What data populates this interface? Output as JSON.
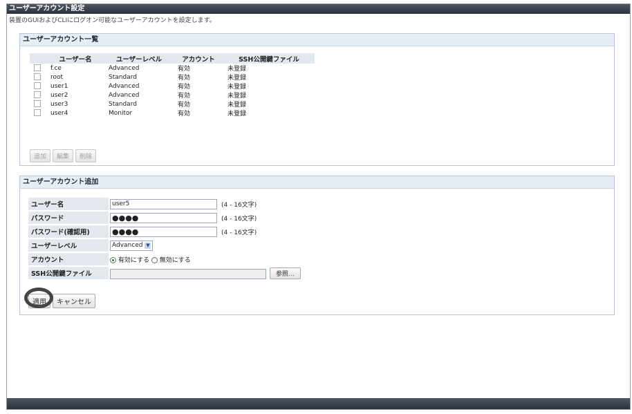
{
  "window": {
    "title": "ユーザーアカウント設定",
    "subtitle": "装置のGUIおよびCLIにログオン可能なユーザーアカウントを設定します。"
  },
  "list_panel": {
    "title": "ユーザーアカウント一覧",
    "columns": [
      "ユーザー名",
      "ユーザーレベル",
      "アカウント",
      "SSH公開鍵ファイル"
    ],
    "rows": [
      {
        "name": "f.ce",
        "level": "Advanced",
        "account": "有効",
        "ssh": "未登録"
      },
      {
        "name": "root",
        "level": "Standard",
        "account": "有効",
        "ssh": "未登録"
      },
      {
        "name": "user1",
        "level": "Advanced",
        "account": "有効",
        "ssh": "未登録"
      },
      {
        "name": "user2",
        "level": "Advanced",
        "account": "有効",
        "ssh": "未登録"
      },
      {
        "name": "user3",
        "level": "Standard",
        "account": "有効",
        "ssh": "未登録"
      },
      {
        "name": "user4",
        "level": "Monitor",
        "account": "有効",
        "ssh": "未登録"
      }
    ],
    "buttons": {
      "add": "追加",
      "edit": "編集",
      "delete": "削除"
    }
  },
  "add_panel": {
    "title": "ユーザーアカウント追加",
    "fields": {
      "username_label": "ユーザー名",
      "username_value": "user5",
      "username_note": "(4 - 16文字)",
      "password_label": "パスワード",
      "password_value": "●●●●",
      "password_note": "(4 - 16文字)",
      "confirm_label": "パスワード(確認用)",
      "confirm_value": "●●●●",
      "confirm_note": "(4 - 16文字)",
      "level_label": "ユーザーレベル",
      "level_value": "Advanced",
      "account_label": "アカウント",
      "account_enable": "有効にする",
      "account_disable": "無効にする",
      "ssh_label": "SSH公開鍵ファイル",
      "browse_label": "参照..."
    },
    "buttons": {
      "apply": "適用",
      "cancel": "キャンセル"
    }
  }
}
